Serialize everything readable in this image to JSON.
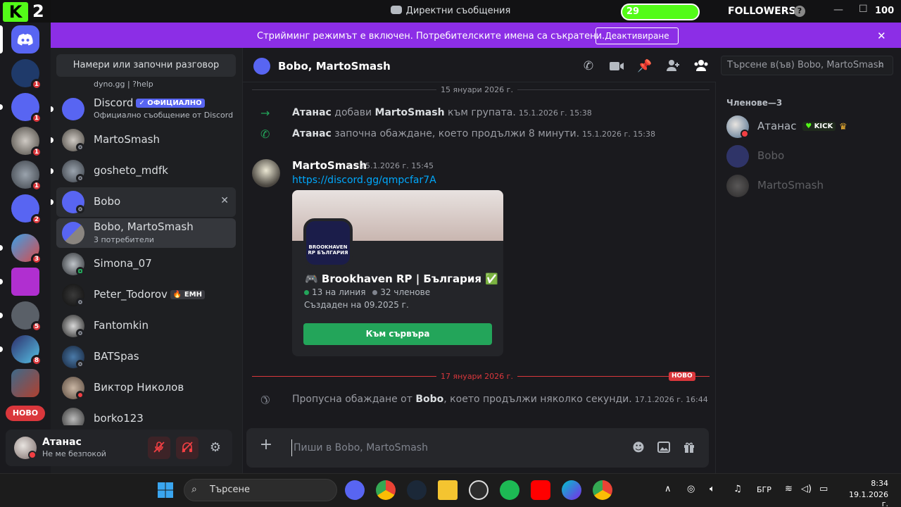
{
  "titlebar": {
    "title": "Директни съобщения",
    "kick_letter": "K",
    "kick_number": "2",
    "followers_count": "29",
    "followers_label": "FOLLOWERS",
    "followers_goal": "100",
    "followers_progress": 0.29,
    "help": "?",
    "minimize": "—",
    "maximize": "☐"
  },
  "server_rail": {
    "new_label": "НОВО",
    "badges": [
      "1",
      "1",
      "1",
      "1",
      "2",
      "3",
      "5",
      "8"
    ]
  },
  "banner": {
    "text": "Стрийминг режимът е включен. Потребителските имена са съкратени.",
    "button": "Деактивиране",
    "close": "✕"
  },
  "dm_list": {
    "search_placeholder": "Намери или започни разговор",
    "partial_item": "dyno.gg | ?help",
    "items": [
      {
        "name": "Discord",
        "tag": "✓ ОФИЦИАЛНО",
        "sub": "Официално съобщение от Discord"
      },
      {
        "name": "MartoSmash"
      },
      {
        "name": "gosheto_mdfk"
      },
      {
        "name": "Bobo",
        "close": "✕"
      },
      {
        "name": "Bobo, MartoSmash",
        "sub": "3 потребители"
      },
      {
        "name": "Simona_07"
      },
      {
        "name": "Peter_Todorov",
        "tag": "🔥 EMH"
      },
      {
        "name": "Fantomkin"
      },
      {
        "name": "BATSpas"
      },
      {
        "name": "Виктор Николов"
      },
      {
        "name": "borko123"
      }
    ]
  },
  "user_panel": {
    "name": "Атанас",
    "status": "Не ме безпокой"
  },
  "chat": {
    "title": "Bobo, MartoSmash",
    "search_placeholder": "Търсене в(ъв) Bobo, MartoSmash",
    "date_1": "15 януари 2026 г.",
    "system_1": {
      "actor": "Атанас",
      "action": "добави",
      "target": "MartoSmash",
      "suffix": "към групата.",
      "time": "15.1.2026 г. 15:38"
    },
    "system_2": {
      "actor": "Атанас",
      "action": "започна обаждане, което продължи 8 минути.",
      "time": "15.1.2026 г. 15:38"
    },
    "message": {
      "author": "MartoSmash",
      "time": "15.1.2026 г. 15:45",
      "link": "https://discord.gg/qmpcfar7A"
    },
    "invite": {
      "icon_text": "BROOKHAVEN RP БЪЛГАРИЯ",
      "name": "🎮 Brookhaven RP | България ✅",
      "online": "13 на линия",
      "members": "32 членове",
      "created": "Създаден на 09.2025 г.",
      "button": "Към сървъра"
    },
    "date_2": "17 януари 2026 г.",
    "new_badge": "НОВО",
    "missed": {
      "prefix": "Пропусна обаждане от",
      "actor": "Bobo",
      "suffix": ", което продължи няколко секунди.",
      "time": "17.1.2026 г. 16:44"
    },
    "composer_placeholder": "Пиши в Bobo, MartoSmash"
  },
  "members": {
    "title": "Членове—3",
    "list": [
      {
        "name": "Атанас",
        "tag": "KICK"
      },
      {
        "name": "Bobo"
      },
      {
        "name": "MartoSmash"
      }
    ]
  },
  "taskbar": {
    "search": "Търсене",
    "lang": "БГР",
    "time": "8:34",
    "date": "19.1.2026 г."
  }
}
